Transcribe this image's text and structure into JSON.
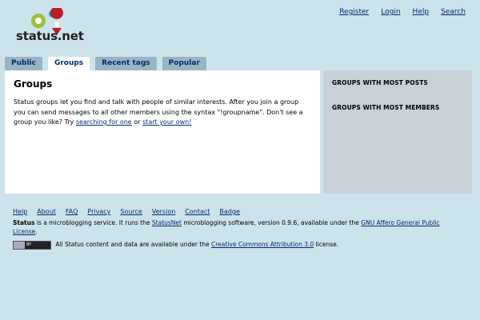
{
  "site": {
    "logo_text": "status.net",
    "logo_colors": {
      "green": "#9fc03a",
      "blue": "#3b8fc9",
      "red": "#b3202a",
      "gray": "#555555"
    }
  },
  "topnav": {
    "register": "Register",
    "login": "Login",
    "help": "Help",
    "search": "Search"
  },
  "tabs": [
    {
      "label": "Public",
      "active": false
    },
    {
      "label": "Groups",
      "active": true
    },
    {
      "label": "Recent tags",
      "active": false
    },
    {
      "label": "Popular",
      "active": false
    }
  ],
  "main": {
    "title": "Groups",
    "intro_part1": "Status groups let you find and talk with people of similar interests. After you join a group you can send messages to all other members using the syntax \"!groupname\". Don't see a group you like? Try ",
    "link_search": "searching for one",
    "intro_part2": " or ",
    "link_create": "start your own!"
  },
  "aside": {
    "section1": "Groups with most posts",
    "section2": "Groups with most members"
  },
  "footer": {
    "nav": [
      "Help",
      "About",
      "FAQ",
      "Privacy",
      "Source",
      "Version",
      "Contact",
      "Badge"
    ],
    "site_name": "Status",
    "about_part1": " is a microblogging service. It runs the ",
    "statusnet_link": "StatusNet",
    "about_part2": " microblogging software, version 0.9.6, available under the ",
    "license_link": "GNU Affero General Public License",
    "about_part3": ".",
    "cc_badge_text": "BY",
    "content_part1": " All Status content and data are available under the ",
    "cc_link": "Creative Commons Attribution 3.0",
    "content_part2": " license."
  },
  "colors": {
    "page_bg": "#cde3ec",
    "link": "#002e6e",
    "tab_bg": "#9bb4c4",
    "aside_bg": "#c8d1d8"
  }
}
